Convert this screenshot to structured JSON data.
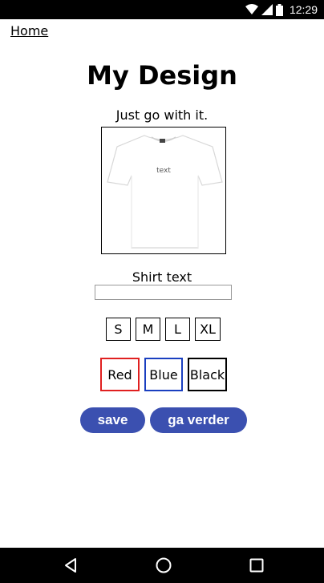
{
  "status_bar": {
    "time": "12:29",
    "icons": [
      "wifi-icon",
      "signal-icon",
      "battery-icon"
    ]
  },
  "nav": {
    "home_link": "Home"
  },
  "page": {
    "title": "My Design",
    "subtitle": "Just go with it."
  },
  "preview": {
    "shirt_text": "text",
    "shirt_color": "#ffffff"
  },
  "shirt_text_field": {
    "label": "Shirt text",
    "value": "",
    "placeholder": ""
  },
  "sizes": [
    "S",
    "M",
    "L",
    "XL"
  ],
  "colors": [
    {
      "label": "Red",
      "border": "#e02020"
    },
    {
      "label": "Blue",
      "border": "#1a3fc0"
    },
    {
      "label": "Black",
      "border": "#000000"
    }
  ],
  "actions": {
    "save_label": "save",
    "next_label": "ga verder",
    "accent": "#3b50b0"
  },
  "system_nav": [
    "back-icon",
    "home-icon",
    "recents-icon"
  ]
}
